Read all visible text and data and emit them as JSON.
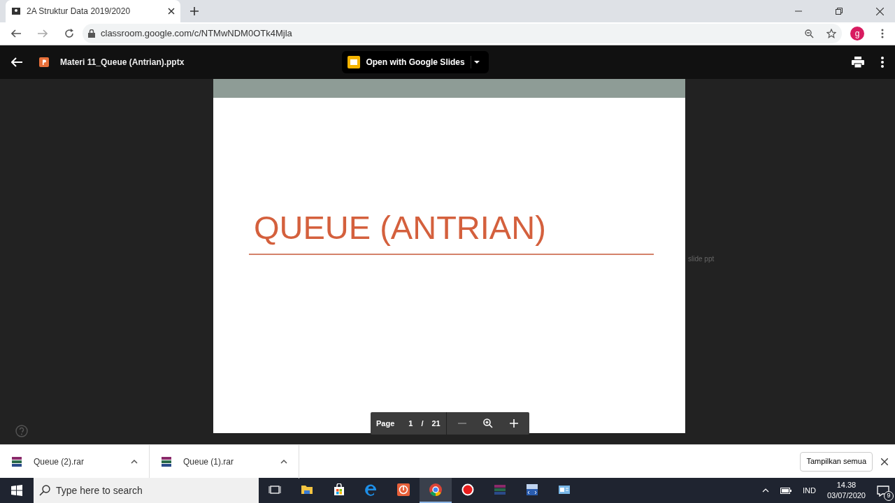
{
  "browser": {
    "tab_title": "2A Struktur Data 2019/2020",
    "url": "classroom.google.com/c/NTMwNDM0OTk4Mjla",
    "profile_initial": "g"
  },
  "viewer": {
    "file_name": "Materi 11_Queue (Antrian).pptx",
    "open_with": "Open with Google Slides",
    "slide_title": "QUEUE (ANTRIAN)",
    "background_text": "slide ppt",
    "page_label": "Page",
    "page_current": "1",
    "page_separator": "/",
    "page_total": "21"
  },
  "downloads": {
    "items": [
      {
        "name": "Queue (2).rar"
      },
      {
        "name": "Queue (1).rar"
      }
    ],
    "show_all": "Tampilkan semua"
  },
  "taskbar": {
    "search_placeholder": "Type here to search",
    "apps": [
      {
        "kind": "taskview",
        "selected": false
      },
      {
        "kind": "folder",
        "selected": false
      },
      {
        "kind": "store",
        "selected": false
      },
      {
        "kind": "edge",
        "selected": false
      },
      {
        "kind": "power",
        "selected": false
      },
      {
        "kind": "chrome",
        "selected": true
      },
      {
        "kind": "record",
        "selected": false
      },
      {
        "kind": "archive",
        "selected": false
      },
      {
        "kind": "dev",
        "selected": false
      },
      {
        "kind": "window",
        "selected": false
      }
    ],
    "language": "IND",
    "time": "14.38",
    "date": "03/07/2020",
    "notification_count": "9"
  }
}
